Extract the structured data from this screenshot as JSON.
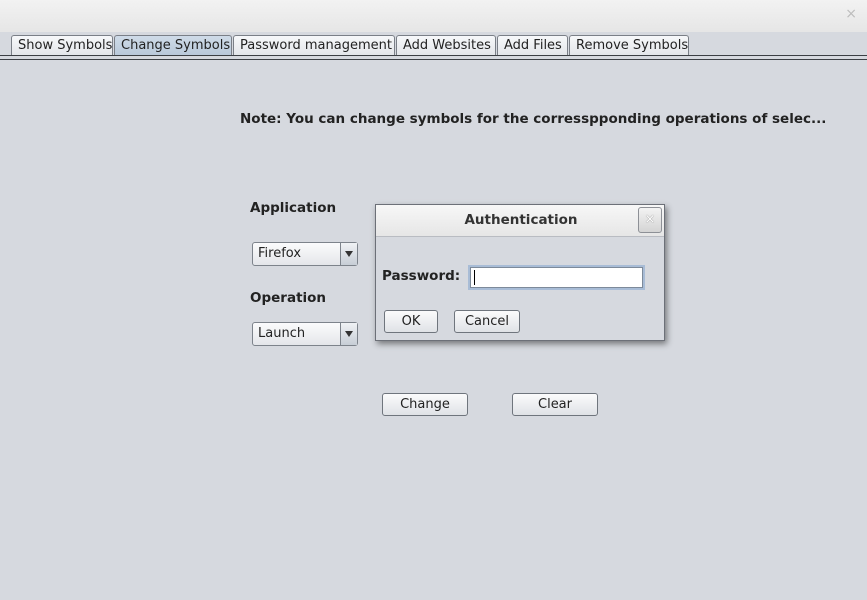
{
  "window": {
    "close_glyph": "×"
  },
  "tabs": [
    {
      "label": "Show Symbols",
      "selected": false
    },
    {
      "label": "Change Symbols",
      "selected": true
    },
    {
      "label": "Password management",
      "selected": false
    },
    {
      "label": "Add Websites",
      "selected": false
    },
    {
      "label": "Add Files",
      "selected": false
    },
    {
      "label": "Remove Symbols",
      "selected": false
    }
  ],
  "panel": {
    "note": "Note: You can change symbols for the corresspponding operations of selec...",
    "application_label": "Application",
    "application_value": "Firefox",
    "operation_label": "Operation",
    "operation_value": "Launch",
    "change_label": "Change",
    "clear_label": "Clear"
  },
  "dialog": {
    "title": "Authentication",
    "close_glyph": "×",
    "password_label": "Password:",
    "password_value": "",
    "ok_label": "OK",
    "cancel_label": "Cancel"
  }
}
